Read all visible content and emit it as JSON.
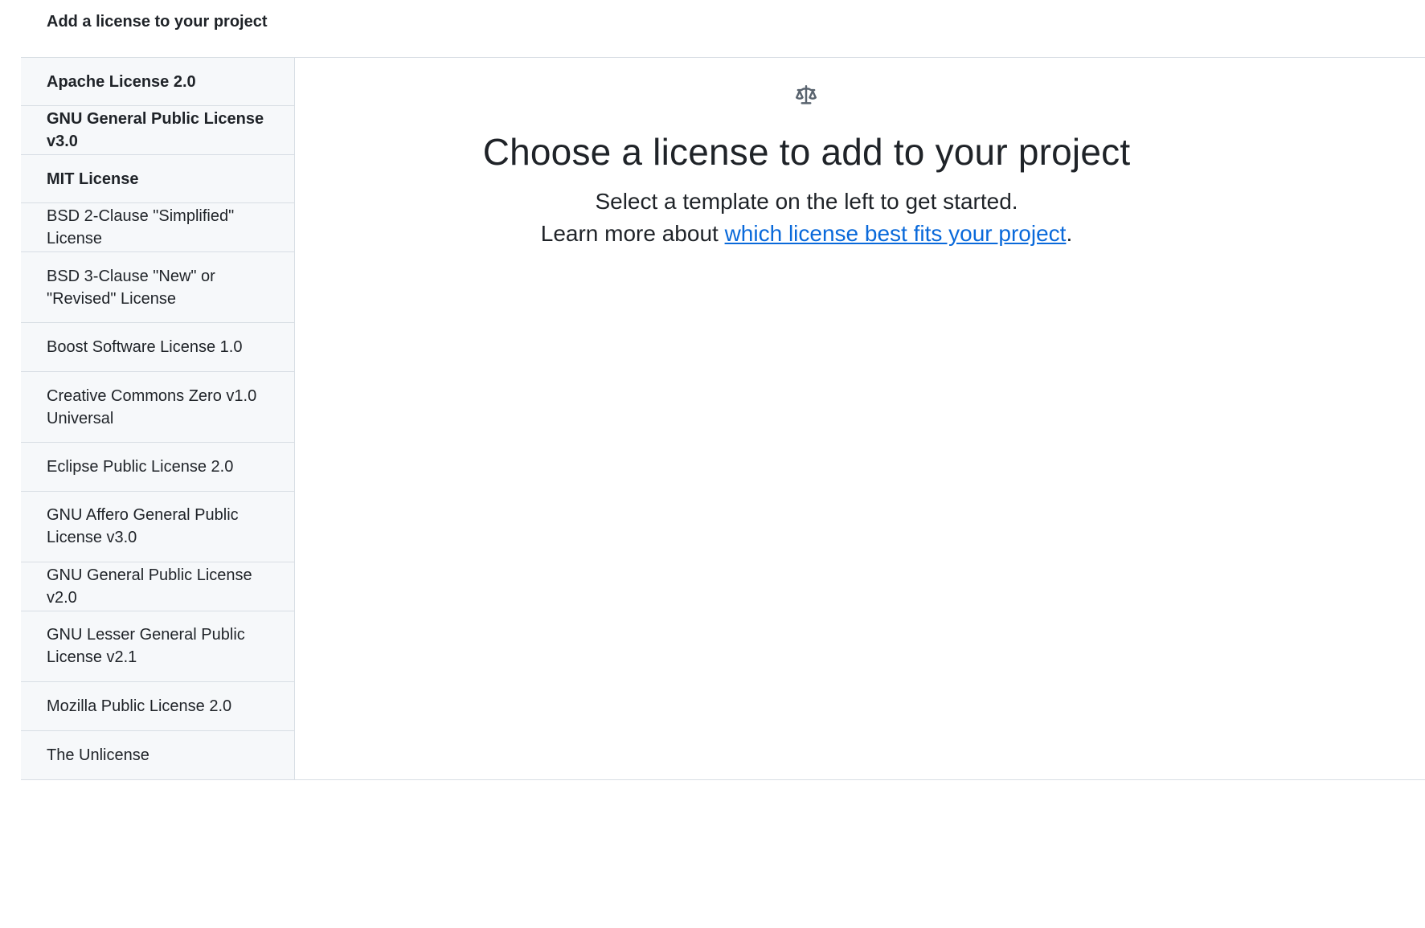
{
  "header": {
    "title": "Add a license to your project"
  },
  "sidebar": {
    "items": [
      {
        "label": "Apache License 2.0",
        "featured": true
      },
      {
        "label": "GNU General Public License v3.0",
        "featured": true
      },
      {
        "label": "MIT License",
        "featured": true
      },
      {
        "label": "BSD 2-Clause \"Simplified\" License",
        "featured": false
      },
      {
        "label": "BSD 3-Clause \"New\" or \"Revised\" License",
        "featured": false
      },
      {
        "label": "Boost Software License 1.0",
        "featured": false
      },
      {
        "label": "Creative Commons Zero v1.0 Universal",
        "featured": false
      },
      {
        "label": "Eclipse Public License 2.0",
        "featured": false
      },
      {
        "label": "GNU Affero General Public License v3.0",
        "featured": false
      },
      {
        "label": "GNU General Public License v2.0",
        "featured": false
      },
      {
        "label": "GNU Lesser General Public License v2.1",
        "featured": false
      },
      {
        "label": "Mozilla Public License 2.0",
        "featured": false
      },
      {
        "label": "The Unlicense",
        "featured": false
      }
    ]
  },
  "main": {
    "icon": "law-scale-icon",
    "title": "Choose a license to add to your project",
    "subtitle": "Select a template on the left to get started.",
    "learn_prefix": "Learn more about ",
    "learn_link": "which license best fits your project",
    "learn_suffix": "."
  },
  "colors": {
    "link": "#0969da",
    "sidebar_bg": "#f6f8fa",
    "border": "#d8dee4",
    "text": "#1f2328"
  }
}
